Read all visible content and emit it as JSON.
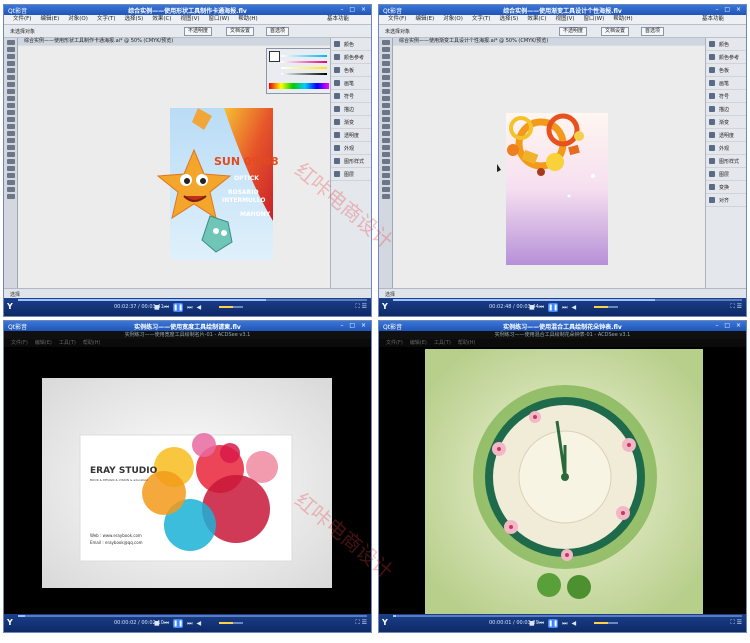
{
  "panels": [
    {
      "app": "Qt影音",
      "title": "综合实例——使用形状工具制作卡通海报.flv",
      "menu": [
        "文件(F)",
        "编辑(E)",
        "对象(O)",
        "文字(T)",
        "选择(S)",
        "效果(C)",
        "视图(V)",
        "窗口(W)",
        "帮助(H)"
      ],
      "workspace": "基本功能",
      "options_label": "未选择对象",
      "options_buttons": [
        "不透明度",
        "文档设置",
        "首选项"
      ],
      "doc_tab": "综合实例——使用形状工具制作卡通海报.ai* @ 50% (CMYK/预览)",
      "status": "选择",
      "time": "00:02:37 / 00:03:41",
      "progress": 0.71,
      "poster": {
        "date": "SUN 09/08",
        "line1": "OPTICK",
        "line2": "ROSARIO",
        "line3": "INTERMULLO",
        "line4": "MAHONY"
      },
      "dock": [
        "颜色",
        "颜色参考",
        "色板",
        "画笔",
        "符号",
        "描边",
        "渐变",
        "透明度",
        "外观",
        "图形样式",
        "图层"
      ]
    },
    {
      "app": "Qt影音",
      "title": "综合实例——使用渐变工具设计个性海报.flv",
      "menu": [
        "文件(F)",
        "编辑(E)",
        "对象(O)",
        "文字(T)",
        "选择(S)",
        "效果(C)",
        "视图(V)",
        "窗口(W)",
        "帮助(H)"
      ],
      "workspace": "基本功能",
      "options_label": "未选择对象",
      "options_buttons": [
        "不透明度",
        "文档设置",
        "首选项"
      ],
      "doc_tab": "综合实例——使用渐变工具设计个性海报.ai* @ 50% (CMYK/预览)",
      "status": "选择",
      "time": "00:02:48 / 00:03:44",
      "progress": 0.75,
      "dock": [
        "颜色",
        "颜色参考",
        "色板",
        "画笔",
        "符号",
        "描边",
        "渐变",
        "透明度",
        "外观",
        "图形样式",
        "图层",
        "变换",
        "对齐"
      ]
    },
    {
      "app": "Qt影音",
      "title": "实例练习——使用宽度工具绘制请柬.flv",
      "sub_title": "实例练习——使用宽度工具绘制名片-01 - ACDSee v3.1",
      "menu": [
        "文件(F)",
        "编辑(E)",
        "工具(T)",
        "帮助(H)"
      ],
      "time": "00:00:02 / 00:02:10",
      "progress": 0.02,
      "card": {
        "studio": "ERAY STUDIO",
        "tagline": "BOOK & DESIGN & VISION & education",
        "web": "Web : www.eraybook.com",
        "email": "Email : eraybook@qq.com"
      }
    },
    {
      "app": "Qt影音",
      "title": "实例练习——使用混合工具绘制花朵钟表.flv",
      "sub_title": "实例练习——使用混合工具绘制花朵钟表-01 - ACDSee v3.1",
      "menu": [
        "文件(F)",
        "编辑(E)",
        "工具(T)",
        "帮助(H)"
      ],
      "time": "00:00:01 / 00:03:29",
      "progress": 0.01
    }
  ],
  "watermark": "红咔电商设计"
}
